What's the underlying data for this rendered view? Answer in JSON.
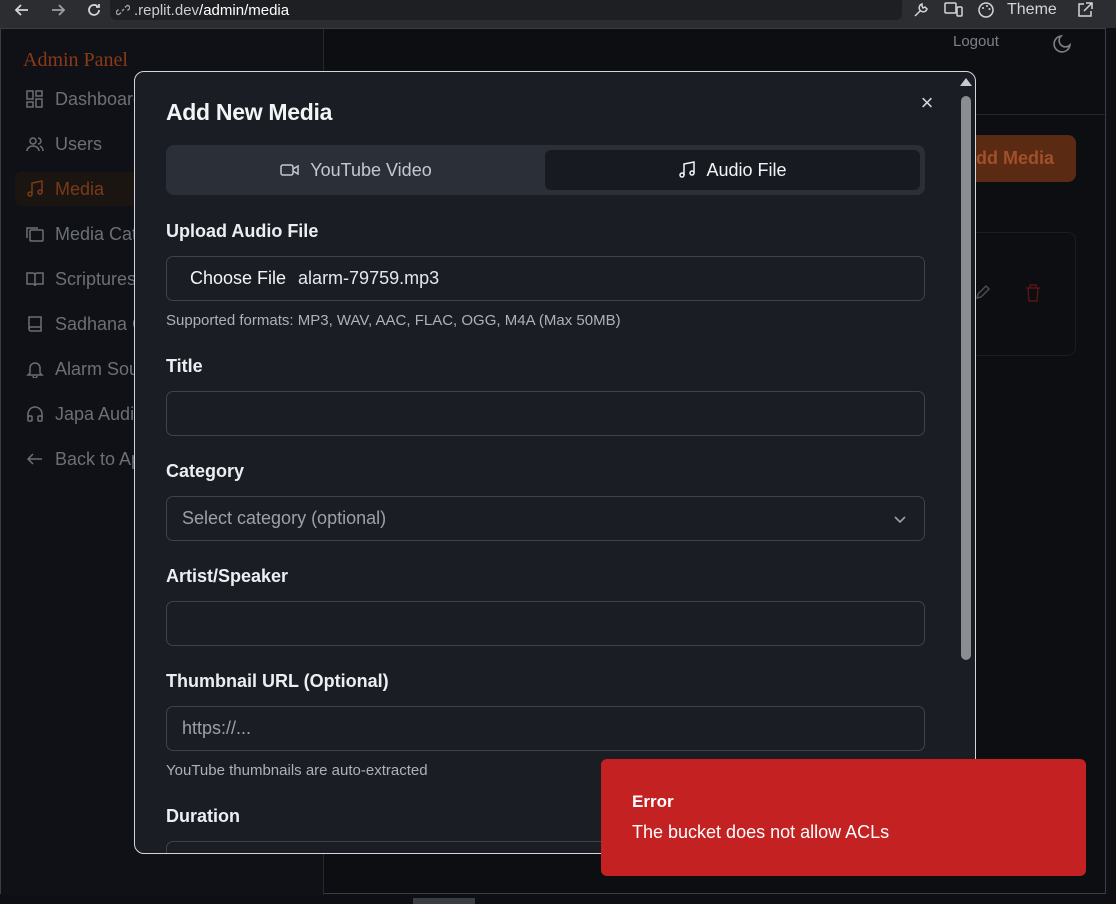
{
  "browser": {
    "url_domain": ".replit.dev",
    "url_path": "/admin/media",
    "theme_label": "Theme"
  },
  "sidebar": {
    "title": "Admin Panel",
    "items": [
      {
        "label": "Dashboard",
        "icon": "dashboard-icon"
      },
      {
        "label": "Users",
        "icon": "users-icon"
      },
      {
        "label": "Media",
        "icon": "music-icon"
      },
      {
        "label": "Media Categories",
        "icon": "folders-icon"
      },
      {
        "label": "Scriptures",
        "icon": "book-open-icon"
      },
      {
        "label": "Sadhana Guides",
        "icon": "book-icon"
      },
      {
        "label": "Alarm Sounds",
        "icon": "bell-icon"
      },
      {
        "label": "Japa Audio",
        "icon": "headphones-icon"
      },
      {
        "label": "Back to App",
        "icon": "arrow-left-icon"
      }
    ]
  },
  "header": {
    "logout_label": "Logout",
    "add_media_label": "Add Media"
  },
  "modal": {
    "title": "Add New Media",
    "close_symbol": "×",
    "tabs": [
      {
        "label": "YouTube Video",
        "icon": "video-icon",
        "active": false
      },
      {
        "label": "Audio File",
        "icon": "music-icon",
        "active": true
      }
    ],
    "upload": {
      "label": "Upload Audio File",
      "button_label": "Choose File",
      "file_name": "alarm-79759.mp3",
      "hint": "Supported formats: MP3, WAV, AAC, FLAC, OGG, M4A (Max 50MB)"
    },
    "title_field": {
      "label": "Title",
      "value": ""
    },
    "category": {
      "label": "Category",
      "placeholder": "Select category (optional)"
    },
    "artist": {
      "label": "Artist/Speaker",
      "value": ""
    },
    "thumbnail": {
      "label": "Thumbnail URL (Optional)",
      "placeholder": "https://...",
      "hint": "YouTube thumbnails are auto-extracted"
    },
    "duration": {
      "label": "Duration"
    }
  },
  "toast": {
    "title": "Error",
    "message": "The bucket does not allow ACLs"
  },
  "colors": {
    "toast_bg": "#c42222",
    "accent": "#8a3a17"
  }
}
